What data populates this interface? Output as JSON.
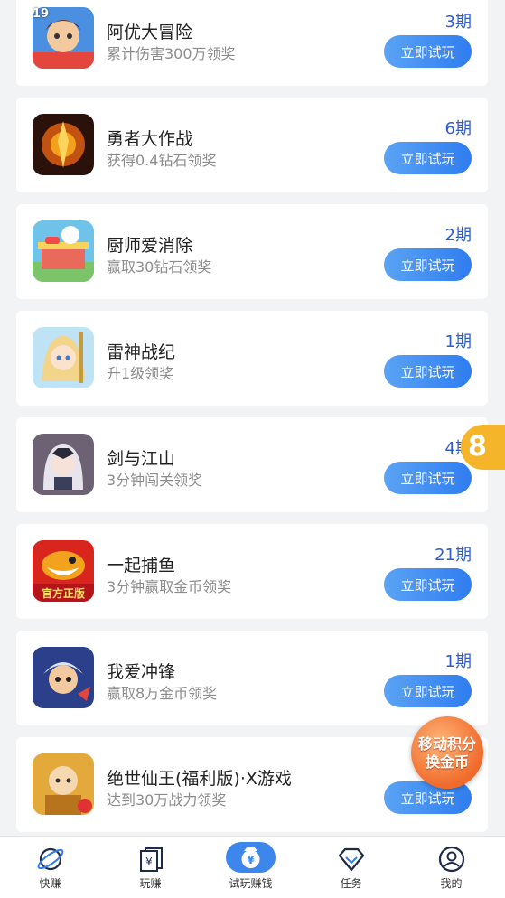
{
  "status_time": "19",
  "colors": {
    "accent": "#2f7df0",
    "period": "#2f5ccf",
    "background": "#f2f3f5"
  },
  "games": [
    {
      "title": "阿优大冒险",
      "subtitle": "累计伤害300万领奖",
      "period": "3期",
      "button": "立即试玩",
      "icon": "hero-boy-icon"
    },
    {
      "title": "勇者大作战",
      "subtitle": "获得0.4钻石领奖",
      "period": "6期",
      "button": "立即试玩",
      "icon": "fire-warrior-icon"
    },
    {
      "title": "厨师爱消除",
      "subtitle": "赢取30钻石领奖",
      "period": "2期",
      "button": "立即试玩",
      "icon": "cafe-shop-icon"
    },
    {
      "title": "雷神战纪",
      "subtitle": "升1级领奖",
      "period": "1期",
      "button": "立即试玩",
      "icon": "anime-girl-icon"
    },
    {
      "title": "剑与江山",
      "subtitle": "3分钟闯关领奖",
      "period": "4期",
      "button": "立即试玩",
      "icon": "white-hair-girl-icon"
    },
    {
      "title": "一起捕鱼",
      "subtitle": "3分钟赢取金币领奖",
      "period": "21期",
      "button": "立即试玩",
      "icon": "shark-fishing-icon",
      "badge": "官方正版"
    },
    {
      "title": "我爱冲锋",
      "subtitle": "赢取8万金币领奖",
      "period": "1期",
      "button": "立即试玩",
      "icon": "blue-warrior-icon"
    },
    {
      "title": "绝世仙王(福利版)·X游戏",
      "subtitle": "达到30万战力领奖",
      "period": "",
      "button": "立即试玩",
      "icon": "golden-monk-icon"
    }
  ],
  "float_orange": {
    "line1": "移动积分",
    "line2": "换金币"
  },
  "tabs": [
    {
      "label": "快赚",
      "icon": "planet-icon"
    },
    {
      "label": "玩赚",
      "icon": "money-cards-icon"
    },
    {
      "label": "试玩赚钱",
      "icon": "yuan-bag-icon",
      "active": true
    },
    {
      "label": "任务",
      "icon": "diamond-icon"
    },
    {
      "label": "我的",
      "icon": "user-icon"
    }
  ]
}
